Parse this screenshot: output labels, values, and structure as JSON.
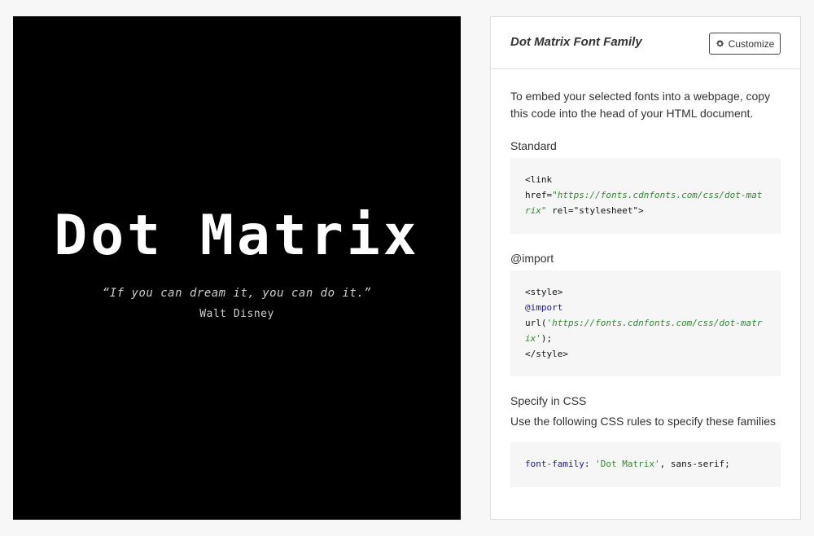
{
  "preview": {
    "title": "Dot Matrix",
    "quote": "“If you can dream it, you can do it.”",
    "author": "Walt Disney"
  },
  "panel": {
    "title": "Dot Matrix Font Family",
    "customize_label": "Customize",
    "intro": "To embed your selected fonts into a webpage, copy this code into the head of your HTML document.",
    "standard_label": "Standard",
    "standard_code": {
      "l1": "<link",
      "href_attr": "href=",
      "href_val": "\"https://fonts.cdnfonts.com/css/dot-matrix\"",
      "rel": " rel=\"stylesheet\">"
    },
    "import_label": "@import",
    "import_code": {
      "l1": "<style>",
      "l2": "@import",
      "url_open": "url(",
      "url_val": "'https://fonts.cdnfonts.com/css/dot-matrix'",
      "url_close": ");",
      "l4": "</style>"
    },
    "css_label": "Specify in CSS",
    "css_desc": "Use the following CSS rules to specify these families",
    "css_code": {
      "prop": "font-family",
      "colon": ": ",
      "val": "'Dot Matrix'",
      "rest": ", sans-serif;"
    }
  },
  "colors": {
    "preview_bg": "#000000",
    "page_bg": "#f7f7f7",
    "string_green": "#2f8a2f"
  }
}
